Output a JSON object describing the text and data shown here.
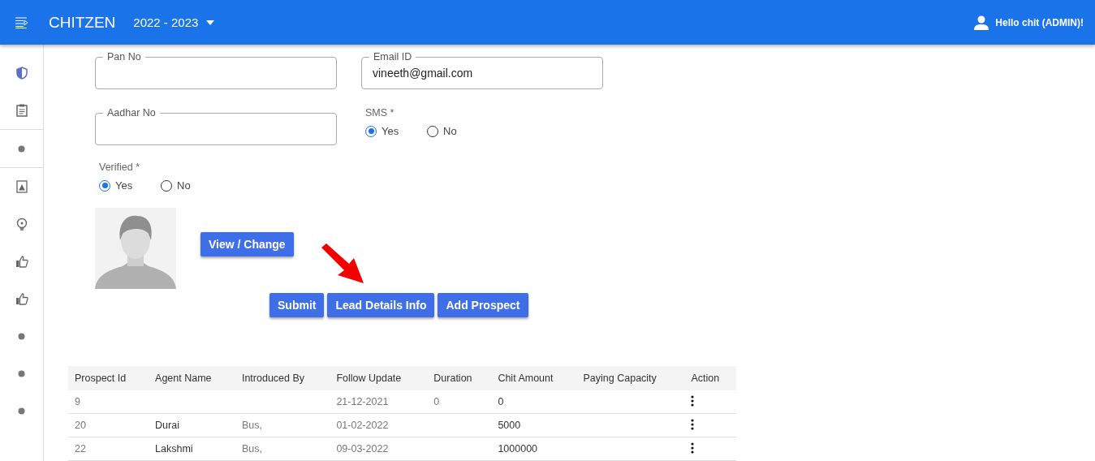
{
  "header": {
    "brand": "CHITZEN",
    "year": "2022 - 2023",
    "user": "Hello chit (ADMIN)!"
  },
  "sidebar": {
    "items": [
      {
        "kind": "shield"
      },
      {
        "kind": "clipboard"
      },
      {
        "kind": "divider"
      },
      {
        "kind": "dot"
      },
      {
        "kind": "divider"
      },
      {
        "kind": "contact"
      },
      {
        "kind": "bulb"
      },
      {
        "kind": "thumb"
      },
      {
        "kind": "thumb"
      },
      {
        "kind": "dot"
      },
      {
        "kind": "dot"
      },
      {
        "kind": "dot"
      }
    ]
  },
  "form": {
    "pan": {
      "label": "Pan No"
    },
    "email": {
      "label": "Email ID",
      "value": "vineeth@gmail.com"
    },
    "aadhar": {
      "label": "Aadhar No"
    },
    "sms": {
      "label": "SMS *",
      "options": [
        {
          "label": "Yes",
          "selected": true
        },
        {
          "label": "No",
          "selected": false
        }
      ]
    },
    "verified": {
      "label": "Verified *",
      "options": [
        {
          "label": "Yes",
          "selected": true
        },
        {
          "label": "No",
          "selected": false
        }
      ]
    },
    "photo_button": "View / Change",
    "buttons": [
      "Submit",
      "Lead Details Info",
      "Add Prospect"
    ]
  },
  "table": {
    "columns": [
      "Prospect Id",
      "Agent Name",
      "Introduced By",
      "Follow Update",
      "Duration",
      "Chit Amount",
      "Paying Capacity",
      "Action"
    ],
    "rows": [
      {
        "cells": [
          "9",
          "",
          "",
          "21-12-2021",
          "0",
          "0",
          ""
        ]
      },
      {
        "cells": [
          "20",
          "Durai",
          "Bus,",
          "01-02-2022",
          "",
          "5000",
          ""
        ]
      },
      {
        "cells": [
          "22",
          "Lakshmi",
          "Bus,",
          "09-03-2022",
          "",
          "1000000",
          ""
        ]
      }
    ]
  }
}
